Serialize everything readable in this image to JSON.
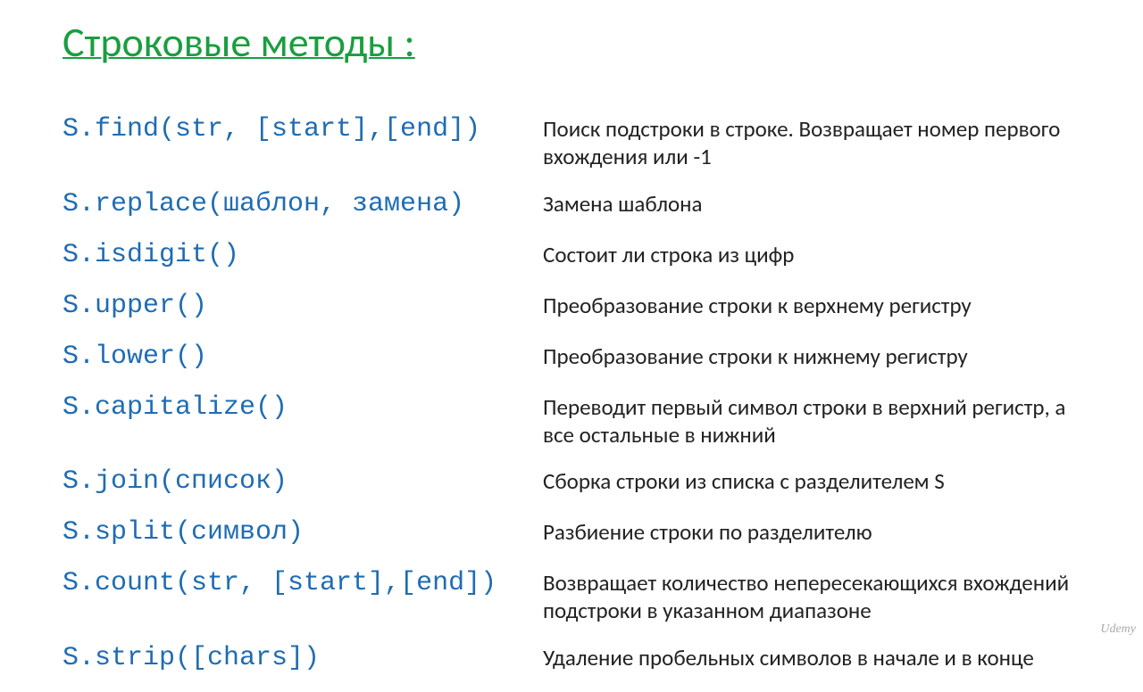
{
  "title": "Строковые методы :",
  "methods": [
    {
      "code": "S.find(str, [start],[end])",
      "desc": "Поиск подстроки в строке. Возвращает номер первого вхождения или -1"
    },
    {
      "code": "S.replace(шаблон, замена)",
      "desc": "Замена шаблона"
    },
    {
      "code": "S.isdigit()",
      "desc": "Состоит ли строка из цифр"
    },
    {
      "code": "S.upper()",
      "desc": "Преобразование строки к верхнему регистру"
    },
    {
      "code": "S.lower()",
      "desc": "Преобразование строки к нижнему регистру"
    },
    {
      "code": "S.capitalize()",
      "desc": "Переводит первый символ строки в верхний регистр, а все остальные в нижний"
    },
    {
      "code": "S.join(список)",
      "desc": "Сборка строки из списка с разделителем S"
    },
    {
      "code": "S.split(символ)",
      "desc": "Разбиение строки по разделителю"
    },
    {
      "code": "S.count(str, [start],[end])",
      "desc": "Возвращает количество непересекающихся вхождений подстроки в  указанном диапазоне"
    },
    {
      "code": "S.strip([chars])",
      "desc": "Удаление пробельных символов в начале и в конце"
    }
  ],
  "watermark": "Udemy"
}
